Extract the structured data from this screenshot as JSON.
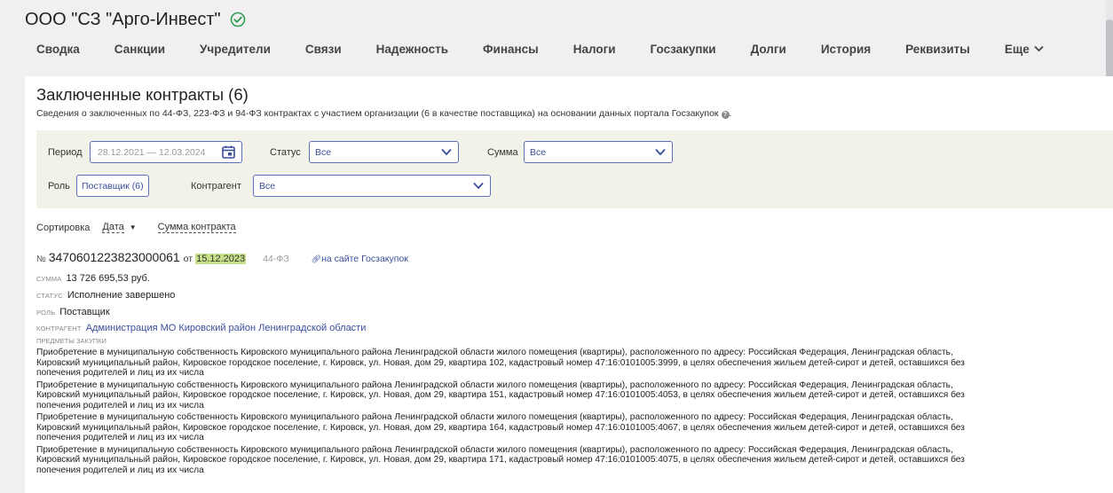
{
  "company": {
    "title": "ООО \"СЗ \"Арго-Инвест\"",
    "verified_color": "#2e9e4f"
  },
  "nav": {
    "items": [
      "Сводка",
      "Санкции",
      "Учредители",
      "Связи",
      "Надежность",
      "Финансы",
      "Налоги",
      "Госзакупки",
      "Долги",
      "История",
      "Реквизиты"
    ],
    "more": "Еще"
  },
  "section": {
    "title": "Заключенные контракты (6)",
    "desc": "Сведения о заключенных по 44-ФЗ, 223-ФЗ и 94-ФЗ контрактах с участием организации (6 в качестве поставщика) на основании данных портала Госзакупок"
  },
  "filters": {
    "period_label": "Период",
    "period_value": "28.12.2021 — 12.03.2024",
    "status_label": "Статус",
    "status_value": "Все",
    "sum_label": "Сумма",
    "sum_value": "Все",
    "role_label": "Роль",
    "role_value": "Поставщик (6)",
    "counterparty_label": "Контрагент",
    "counterparty_value": "Все"
  },
  "sort": {
    "label": "Сортировка",
    "date": "Дата",
    "sum": "Сумма контракта"
  },
  "contract": {
    "no_prefix": "№",
    "number": "3470601223823000061",
    "from": "от",
    "date": "15.12.2023",
    "law": "44-ФЗ",
    "link": "на сайте Госзакупок",
    "sum_label": "Сумма",
    "sum_value": "13 726 695,53 руб.",
    "status_label": "Статус",
    "status_value": "Исполнение завершено",
    "role_label": "Роль",
    "role_value": "Поставщик",
    "counterparty_label": "Контрагент",
    "counterparty_value": "Администрация МО Кировский район Ленинградской области",
    "items_label": "Предметы закупки",
    "items": [
      {
        "l1": "Приобретение в муниципальную собственность Кировского муниципального района Ленинградской области жилого помещения (квартиры), расположенного по адресу: Российская Федерация, Ленинградская область,",
        "l2": "Кировский муниципальный район, Кировское городское поселение, г. Кировск, ул. Новая, дом 29, квартира 102, кадастровый номер 47:16:0101005:3999, в целях обеспечения жильем детей-сирот и детей, оставшихся без",
        "l3": "попечения родителей и лиц из их числа"
      },
      {
        "l1": "Приобретение в муниципальную собственность Кировского муниципального района Ленинградской области жилого помещения (квартиры), расположенного по адресу: Российская Федерация, Ленинградская область,",
        "l2": "Кировский муниципальный район, Кировское городское поселение, г. Кировск, ул. Новая, дом 29, квартира 151, кадастровый номер 47:16:0101005:4053, в целях обеспечения жильем детей-сирот и детей, оставшихся без",
        "l3": "попечения родителей и лиц из их числа"
      },
      {
        "l1": "Приобретение в муниципальную собственность Кировского муниципального района Ленинградской области жилого помещения (квартиры), расположенного по адресу: Российская Федерация, Ленинградская область,",
        "l2": "Кировский муниципальный район, Кировское городское поселение, г. Кировск, ул. Новая, дом 29, квартира 164, кадастровый номер 47:16:0101005:4067, в целях обеспечения жильем детей-сирот и детей, оставшихся без",
        "l3": "попечения родителей и лиц из их числа"
      },
      {
        "l1": "Приобретение в муниципальную собственность Кировского муниципального района Ленинградской области жилого помещения (квартиры), расположенного по адресу: Российская Федерация, Ленинградская область,",
        "l2": "Кировский муниципальный район, Кировское городское поселение, г. Кировск, ул. Новая, дом 29, квартира 171, кадастровый номер 47:16:0101005:4075, в целях обеспечения жильем детей-сирот и детей, оставшихся без",
        "l3": "попечения родителей и лиц из их числа"
      }
    ]
  }
}
